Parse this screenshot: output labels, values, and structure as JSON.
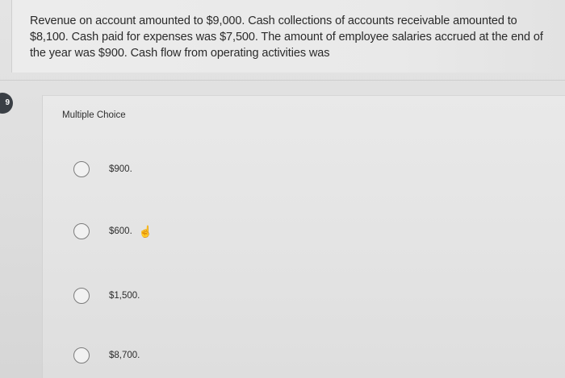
{
  "question": {
    "number": "9",
    "text": "Revenue on account amounted to $9,000. Cash collections of accounts receivable amounted to $8,100. Cash paid for expenses was $7,500. The amount of employee salaries accrued at the end of the year was $900. Cash flow from operating activities was"
  },
  "answer_section": {
    "type_label": "Multiple Choice",
    "options": [
      {
        "label": "$900."
      },
      {
        "label": "$600."
      },
      {
        "label": "$1,500."
      },
      {
        "label": "$8,700."
      }
    ]
  },
  "cursor": {
    "icon": "pointer-hand-icon"
  }
}
